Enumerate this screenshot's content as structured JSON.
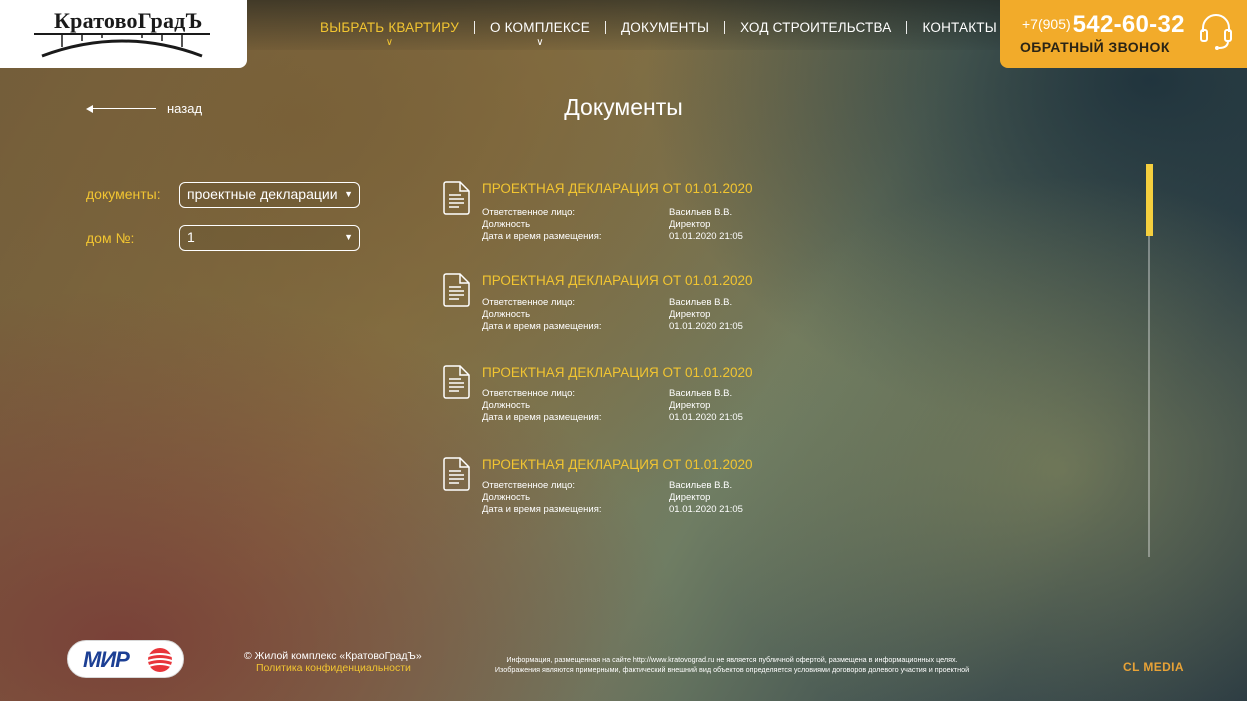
{
  "header": {
    "logo_text": "КратовоГрадЪ",
    "nav": [
      {
        "label": "Выбрать квартиру",
        "active": true,
        "has_dropdown": true
      },
      {
        "label": "О комплексе",
        "active": false,
        "has_dropdown": true
      },
      {
        "label": "Документы",
        "active": false,
        "has_dropdown": false
      },
      {
        "label": "Ход строительства",
        "active": false,
        "has_dropdown": false
      },
      {
        "label": "Контакты",
        "active": false,
        "has_dropdown": false
      }
    ],
    "phone_code": "+7(905)",
    "phone_number": "542-60-32",
    "callback_label": "Обратный звонок",
    "callback_icon": "headset-icon"
  },
  "back_label": "назад",
  "page_title": "Документы",
  "filters": {
    "documents_label": "документы:",
    "documents_value": "проектные декларации",
    "house_label": "дом №:",
    "house_value": "1"
  },
  "documents": [
    {
      "title": "ПРОЕКТНАЯ ДЕКЛАРАЦИЯ ОТ 01.01.2020",
      "rows": [
        {
          "label": "Ответственное лицо:",
          "value": "Васильев В.В."
        },
        {
          "label": "Должность",
          "value": "Директор"
        },
        {
          "label": "Дата и время размещения:",
          "value": "01.01.2020 21:05"
        }
      ]
    },
    {
      "title": "ПРОЕКТНАЯ ДЕКЛАРАЦИЯ ОТ 01.01.2020",
      "rows": [
        {
          "label": "Ответственное лицо:",
          "value": "Васильев В.В."
        },
        {
          "label": "Должность",
          "value": "Директор"
        },
        {
          "label": "Дата и время размещения:",
          "value": "01.01.2020 21:05"
        }
      ]
    },
    {
      "title": "ПРОЕКТНАЯ ДЕКЛАРАЦИЯ ОТ 01.01.2020",
      "rows": [
        {
          "label": "Ответственное лицо:",
          "value": "Васильев В.В."
        },
        {
          "label": "Должность",
          "value": "Директор"
        },
        {
          "label": "Дата и время размещения:",
          "value": "01.01.2020 21:05"
        }
      ]
    },
    {
      "title": "ПРОЕКТНАЯ ДЕКЛАРАЦИЯ ОТ 01.01.2020",
      "rows": [
        {
          "label": "Ответственное лицо:",
          "value": "Васильев В.В."
        },
        {
          "label": "Должность",
          "value": "Директор"
        },
        {
          "label": "Дата и время размещения:",
          "value": "01.01.2020 21:05"
        }
      ]
    }
  ],
  "footer": {
    "mir_logo_text": "МИР",
    "copyright": "© Жилой комплекс «КратовоГрадЪ»",
    "privacy_label": "Политика конфиденциальности",
    "disclaimer_line1": "Информация, размещенная на сайте http://www.kratovograd.ru не является публичной офертой, размещена в информационных целях.",
    "disclaimer_line2": "Изображения являются примерными, фактический внешний вид объектов определяется условиями договоров долевого участия и проектной",
    "developer": "CL MEDIA"
  },
  "colors": {
    "accent_yellow": "#f2c531",
    "callback_orange": "#f2ab2a",
    "mir_blue": "#1c3f94"
  }
}
